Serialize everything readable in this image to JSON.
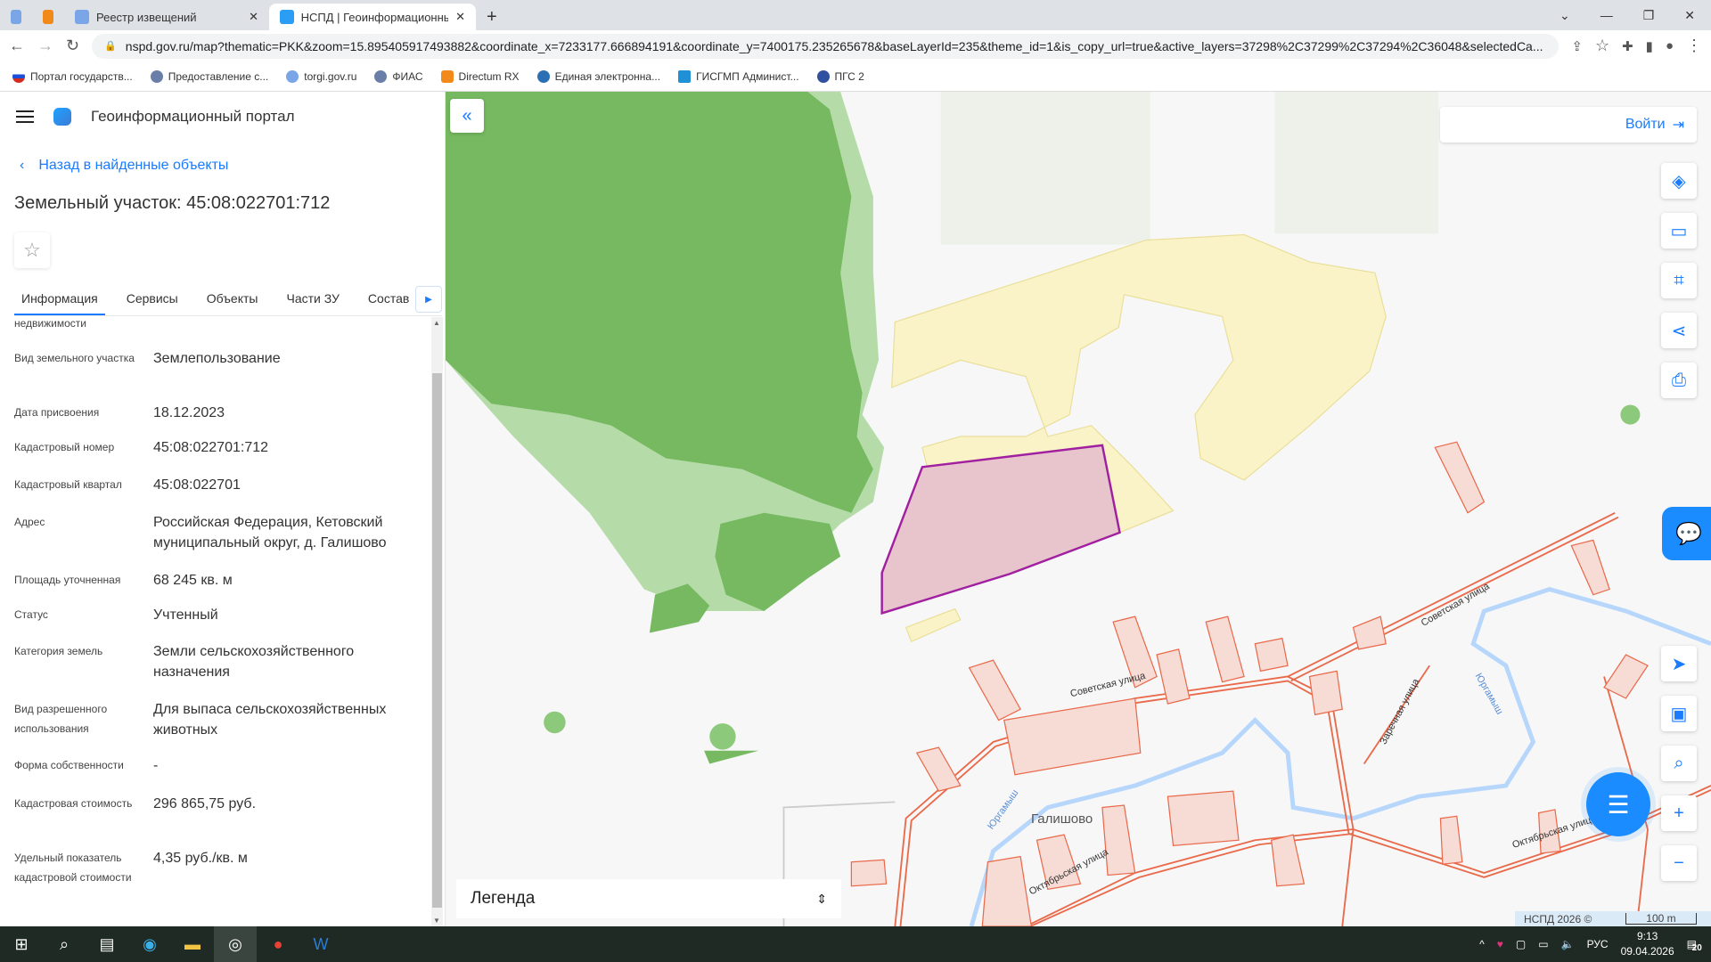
{
  "browser": {
    "tabs": [
      {
        "label": "",
        "icon": "gov-emblem-icon"
      },
      {
        "label": "",
        "icon": "directum-icon"
      },
      {
        "label": "Реестр извещений",
        "icon": "gov-emblem-icon"
      },
      {
        "label": "НСПД | Геоинформационный п",
        "icon": "nspd-icon",
        "active": true
      }
    ],
    "url": "nspd.gov.ru/map?thematic=PKK&zoom=15.895405917493882&coordinate_x=7233177.666894191&coordinate_y=7400175.235265678&baseLayerId=235&theme_id=1&is_copy_url=true&active_layers=37298%2C37299%2C37294%2C36048&selectedCa...",
    "bookmarks": [
      "Портал государств...",
      "Предоставление с...",
      "torgi.gov.ru",
      "ФИАС",
      "Directum RX",
      "Единая электронна...",
      "ГИСГМП Админист...",
      "ПГС 2"
    ]
  },
  "sidebar": {
    "app_title": "Геоинформационный портал",
    "back_link": "Назад в найденные объекты",
    "object_title": "Земельный участок: 45:08:022701:712",
    "tabs": [
      "Информация",
      "Сервисы",
      "Объекты",
      "Части ЗУ",
      "Состав"
    ],
    "cut_label": "недвижимости",
    "fields": [
      {
        "label": "Вид земельного участка",
        "value": "Землепользование"
      },
      {
        "label": "Дата присвоения",
        "value": "18.12.2023"
      },
      {
        "label": "Кадастровый номер",
        "value": "45:08:022701:712"
      },
      {
        "label": "Кадастровый квартал",
        "value": "45:08:022701"
      },
      {
        "label": "Адрес",
        "value": "Российская Федерация, Кетовский муниципальный округ, д. Галишово"
      },
      {
        "label": "Площадь уточненная",
        "value": "68 245 кв. м"
      },
      {
        "label": "Статус",
        "value": "Учтенный"
      },
      {
        "label": "Категория земель",
        "value": "Земли сельскохозяйственного назначения"
      },
      {
        "label": "Вид разрешенного использования",
        "value": "Для выпаса сельскохозяйственных животных"
      },
      {
        "label": "Форма собственности",
        "value": "-"
      },
      {
        "label": "Кадастровая стоимость",
        "value": "296 865,75 руб."
      },
      {
        "label": "Удельный показатель кадастровой стоимости",
        "value": "4,35 руб./кв. м"
      }
    ]
  },
  "map": {
    "login": "Войти",
    "legend": "Легенда",
    "attribution": "НСПД 2026 ©",
    "scale": "100 m",
    "labels": {
      "village": "Галишово",
      "street1": "Советская улица",
      "street2": "Октябрьская улица",
      "street3": "Заречная улица",
      "river": "Юргамыш"
    },
    "colors": {
      "forest": "#76b960",
      "forest_light": "#b5dca8",
      "agri": "#faf3c8",
      "parcel_selected": "#e8c5cc",
      "parcel_border": "#a020a0",
      "parcels": "#e9694a",
      "river": "#b6d6fb",
      "accent": "#1a7bff"
    }
  },
  "taskbar": {
    "lang": "РУС",
    "time": "9:13",
    "date": "09.04.2026",
    "notifications": "20"
  }
}
